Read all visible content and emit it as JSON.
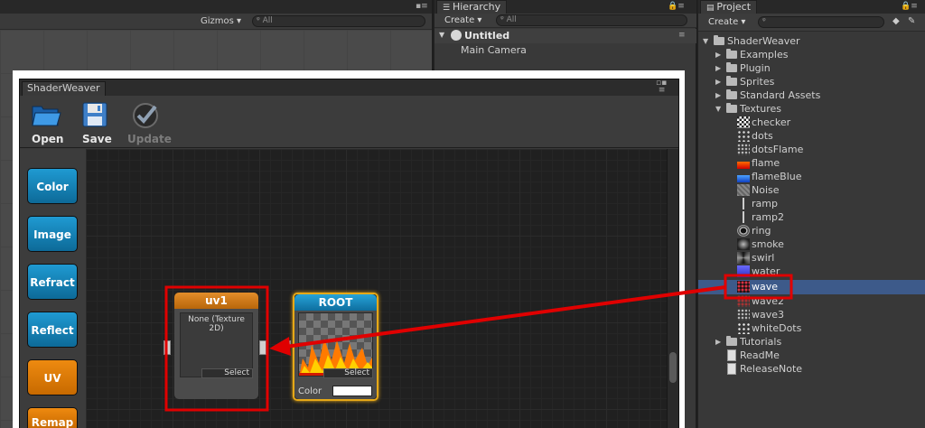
{
  "scene": {
    "gizmos_label": "Gizmos ▾",
    "search_placeholder": "ᵠ All"
  },
  "hierarchy": {
    "tab_label": "Hierarchy",
    "create_label": "Create ▾",
    "search_placeholder": "ᵠ All",
    "scene_name": "Untitled",
    "items": [
      "Main Camera"
    ]
  },
  "project": {
    "tab_label": "Project",
    "create_label": "Create ▾",
    "tree": [
      {
        "label": "ShaderWeaver",
        "kind": "folder",
        "open": true
      },
      {
        "label": "Examples",
        "kind": "folder"
      },
      {
        "label": "Plugin",
        "kind": "folder"
      },
      {
        "label": "Sprites",
        "kind": "folder"
      },
      {
        "label": "Standard Assets",
        "kind": "folder"
      },
      {
        "label": "Textures",
        "kind": "folder",
        "open": true
      },
      {
        "label": "checker",
        "kind": "texture"
      },
      {
        "label": "dots",
        "kind": "texture"
      },
      {
        "label": "dotsFlame",
        "kind": "texture"
      },
      {
        "label": "flame",
        "kind": "texture"
      },
      {
        "label": "flameBlue",
        "kind": "texture"
      },
      {
        "label": "Noise",
        "kind": "texture"
      },
      {
        "label": "ramp",
        "kind": "texture"
      },
      {
        "label": "ramp2",
        "kind": "texture"
      },
      {
        "label": "ring",
        "kind": "texture"
      },
      {
        "label": "smoke",
        "kind": "texture"
      },
      {
        "label": "swirl",
        "kind": "texture"
      },
      {
        "label": "water",
        "kind": "texture"
      },
      {
        "label": "wave",
        "kind": "texture",
        "selected": true
      },
      {
        "label": "wave2",
        "kind": "texture"
      },
      {
        "label": "wave3",
        "kind": "texture"
      },
      {
        "label": "whiteDots",
        "kind": "texture"
      },
      {
        "label": "Tutorials",
        "kind": "folder"
      },
      {
        "label": "ReadMe",
        "kind": "document"
      },
      {
        "label": "ReleaseNote",
        "kind": "document"
      }
    ]
  },
  "shaderweaver": {
    "tab_label": "ShaderWeaver",
    "toolbar": {
      "open_label": "Open",
      "save_label": "Save",
      "update_label": "Update"
    },
    "side_buttons": [
      "Color",
      "Image",
      "Refract",
      "Reflect",
      "UV",
      "Remap"
    ],
    "nodes": {
      "uv1": {
        "title": "uv1",
        "texture_text": "None (Texture 2D)",
        "select_label": "Select"
      },
      "root": {
        "title": "ROOT",
        "select_label": "Select",
        "color_label": "Color"
      }
    }
  },
  "colors": {
    "accent_teal": "#1f9ad2",
    "accent_orange": "#e88510",
    "annotation_red": "#e00000",
    "selection_blue": "#3d5a8a",
    "root_border": "#e6a817"
  }
}
